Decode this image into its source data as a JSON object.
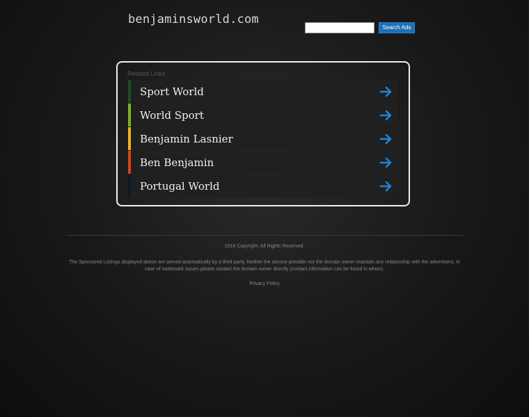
{
  "header": {
    "domain": "benjaminsworld.com",
    "search_value": "",
    "search_button_label": "Search Ads"
  },
  "panel": {
    "heading": "Related Links",
    "links": [
      {
        "label": "Sport World",
        "bar_color": "#1e4d2b"
      },
      {
        "label": "World Sport",
        "bar_color": "#7cb51a"
      },
      {
        "label": "Benjamin Lasnier",
        "bar_color": "#f2b41e"
      },
      {
        "label": "Ben Benjamin",
        "bar_color": "#e0401a"
      },
      {
        "label": "Portugal World",
        "bar_color": "#0e1a24"
      }
    ],
    "arrow_icon": "arrow-right-icon",
    "arrow_color": "#1f84d6"
  },
  "footer": {
    "copyright": "2018 Copyright. All Rights Reserved.",
    "disclaimer": "The Sponsored Listings displayed above are served automatically by a third party. Neither the service provider nor the domain owner maintain any relationship with the advertisers. In case of trademark issues please contact the domain owner directly (contact information can be found in whois).",
    "privacy_label": "Privacy Policy"
  }
}
